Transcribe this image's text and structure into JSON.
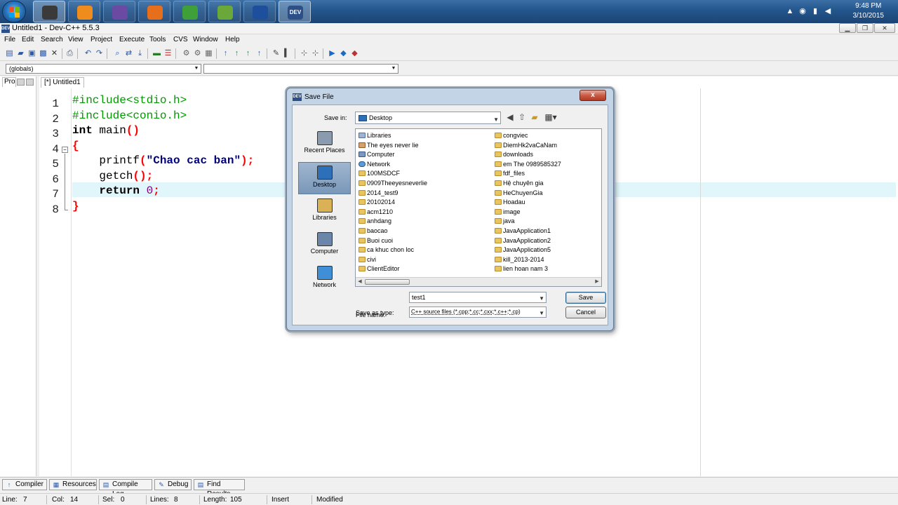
{
  "taskbar": {
    "time": "9:48 PM",
    "date": "3/10/2015",
    "apps": [
      {
        "name": "app-1",
        "color": "#3a3a3a",
        "active": true
      },
      {
        "name": "app-2",
        "color": "#f08c1e",
        "active": false
      },
      {
        "name": "app-3",
        "color": "#6a4aa3",
        "active": false
      },
      {
        "name": "app-4",
        "color": "#e76f1b",
        "active": false
      },
      {
        "name": "app-5",
        "color": "#3fa03a",
        "active": false
      },
      {
        "name": "app-6",
        "color": "#6aa83a",
        "active": false
      },
      {
        "name": "app-7",
        "color": "#1d4f9c",
        "active": false
      },
      {
        "name": "dev-cpp",
        "color": "#2b4f86",
        "active": true,
        "label": "DEV"
      }
    ]
  },
  "window": {
    "title": "Untitled1 - Dev-C++ 5.5.3"
  },
  "menu": [
    "File",
    "Edit",
    "Search",
    "View",
    "Project",
    "Execute",
    "Tools",
    "CVS",
    "Window",
    "Help"
  ],
  "combos": {
    "globals": "(globals)",
    "members": ""
  },
  "project_panel": {
    "tab_label": "Pro"
  },
  "editor": {
    "tab_label": "[*] Untitled1",
    "line_numbers": [
      "1",
      "2",
      "3",
      "4",
      "5",
      "6",
      "7",
      "8"
    ],
    "lines": [
      [
        {
          "t": "#include<stdio.h>",
          "c": "pp"
        }
      ],
      [
        {
          "t": "#include<conio.h>",
          "c": "pp"
        }
      ],
      [
        {
          "t": "int",
          "c": "kw"
        },
        {
          "t": " main",
          "c": "plain"
        },
        {
          "t": "()",
          "c": "sym"
        }
      ],
      [
        {
          "t": "{",
          "c": "sym"
        }
      ],
      [
        {
          "t": "    printf",
          "c": "plain"
        },
        {
          "t": "(",
          "c": "sym"
        },
        {
          "t": "\"Chao cac ban\"",
          "c": "str"
        },
        {
          "t": ");",
          "c": "sym"
        }
      ],
      [
        {
          "t": "    getch",
          "c": "plain"
        },
        {
          "t": "();",
          "c": "sym"
        }
      ],
      [
        {
          "t": "    return",
          "c": "kw"
        },
        {
          "t": " ",
          "c": "plain"
        },
        {
          "t": "0",
          "c": "num"
        },
        {
          "t": ";",
          "c": "sym"
        }
      ],
      [
        {
          "t": "}",
          "c": "sym"
        }
      ]
    ]
  },
  "bottom_tabs": [
    "Compiler",
    "Resources",
    "Compile Log",
    "Debug",
    "Find Results"
  ],
  "status": {
    "line_label": "Line:",
    "line": "7",
    "col_label": "Col:",
    "col": "14",
    "sel_label": "Sel:",
    "sel": "0",
    "lines_label": "Lines:",
    "lines": "8",
    "length_label": "Length:",
    "length": "105",
    "mode": "Insert",
    "state": "Modified"
  },
  "dialog": {
    "title": "Save File",
    "close_label": "x",
    "save_in_label": "Save in:",
    "save_in_value": "Desktop",
    "places": [
      "Recent Places",
      "Desktop",
      "Libraries",
      "Computer",
      "Network"
    ],
    "files_col1": [
      {
        "name": "Libraries",
        "type": "lib"
      },
      {
        "name": "The eyes never lie",
        "type": "user"
      },
      {
        "name": "Computer",
        "type": "comp"
      },
      {
        "name": "Network",
        "type": "net"
      },
      {
        "name": "100MSDCF",
        "type": "folder"
      },
      {
        "name": "0909Theeyesneverlie",
        "type": "folder"
      },
      {
        "name": "2014_test9",
        "type": "folder"
      },
      {
        "name": "20102014",
        "type": "folder"
      },
      {
        "name": "acm1210",
        "type": "folder"
      },
      {
        "name": "anhdang",
        "type": "folder"
      },
      {
        "name": "baocao",
        "type": "folder"
      },
      {
        "name": "Buoi cuoi",
        "type": "folder"
      },
      {
        "name": "ca khuc chon loc",
        "type": "folder"
      },
      {
        "name": "civi",
        "type": "folder"
      },
      {
        "name": "ClientEditor",
        "type": "folder"
      }
    ],
    "files_col2": [
      {
        "name": "congviec",
        "type": "folder"
      },
      {
        "name": "DiemHk2vaCaNam",
        "type": "folder"
      },
      {
        "name": "downloads",
        "type": "folder"
      },
      {
        "name": "em The 0989585327",
        "type": "folder"
      },
      {
        "name": "fdf_files",
        "type": "folder"
      },
      {
        "name": "Hệ chuyên gia",
        "type": "folder"
      },
      {
        "name": "HeChuyenGia",
        "type": "folder"
      },
      {
        "name": "Hoadau",
        "type": "folder"
      },
      {
        "name": "image",
        "type": "folder"
      },
      {
        "name": "java",
        "type": "folder"
      },
      {
        "name": "JavaApplication1",
        "type": "folder"
      },
      {
        "name": "JavaApplication2",
        "type": "folder"
      },
      {
        "name": "JavaApplication5",
        "type": "folder"
      },
      {
        "name": "kill_2013-2014",
        "type": "folder"
      },
      {
        "name": "lien hoan nam 3",
        "type": "folder"
      }
    ],
    "file_name_label": "File name:",
    "file_name_value": "test1",
    "save_as_type_label": "Save as type:",
    "save_as_type_value": "C++ source files (*.cpp;*.cc;*.cxx;*.c++;*.cp)",
    "save_label": "Save",
    "cancel_label": "Cancel"
  }
}
